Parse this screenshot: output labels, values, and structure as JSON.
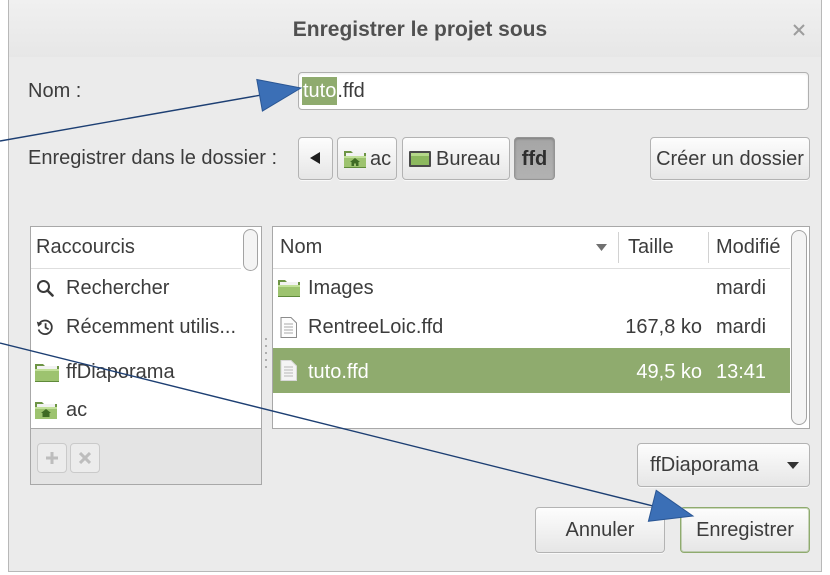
{
  "dialog": {
    "title": "Enregistrer le projet sous",
    "close_icon": "close-icon"
  },
  "name_row": {
    "label": "Nom :",
    "value_selected": "tuto",
    "value_rest": ".ffd"
  },
  "folder_row": {
    "label": "Enregistrer dans le dossier :",
    "back_icon": "go-back-icon",
    "path": [
      {
        "label": "ac",
        "icon": "home-folder-icon",
        "active": false
      },
      {
        "label": "Bureau",
        "icon": "desktop-icon",
        "active": false
      },
      {
        "label": "ffd",
        "active": true
      }
    ],
    "create_folder_label": "Créer un dossier"
  },
  "places": {
    "header": "Raccourcis",
    "items": [
      {
        "label": "Rechercher",
        "icon": "search-icon"
      },
      {
        "label": "Récemment utilis...",
        "icon": "recent-icon"
      },
      {
        "label": "ffDiaporama",
        "icon": "folder-icon"
      },
      {
        "label": "ac",
        "icon": "home-folder-icon"
      }
    ],
    "add_icon": "add-icon",
    "remove_icon": "remove-icon"
  },
  "files": {
    "columns": {
      "name": "Nom",
      "size": "Taille",
      "modified": "Modifié"
    },
    "sort_icon": "sort-descending-icon",
    "rows": [
      {
        "name": "Images",
        "modified": "mardi",
        "icon": "folder-icon",
        "selected": false
      },
      {
        "name": "RentreeLoic.ffd",
        "size": "167,8 ko",
        "modified": "mardi",
        "icon": "document-icon",
        "selected": false
      },
      {
        "name": "tuto.ffd",
        "size": "49,5 ko",
        "modified": "13:41",
        "icon": "document-icon",
        "selected": true
      }
    ]
  },
  "filter": {
    "selected": "ffDiaporama",
    "arrow_icon": "chevron-down-icon"
  },
  "buttons": {
    "cancel": "Annuler",
    "save": "Enregistrer"
  },
  "colors": {
    "selection": "#8fab6e",
    "default_button_border": "#8fab6e",
    "annotation_arrow": "#3b6fb6"
  }
}
